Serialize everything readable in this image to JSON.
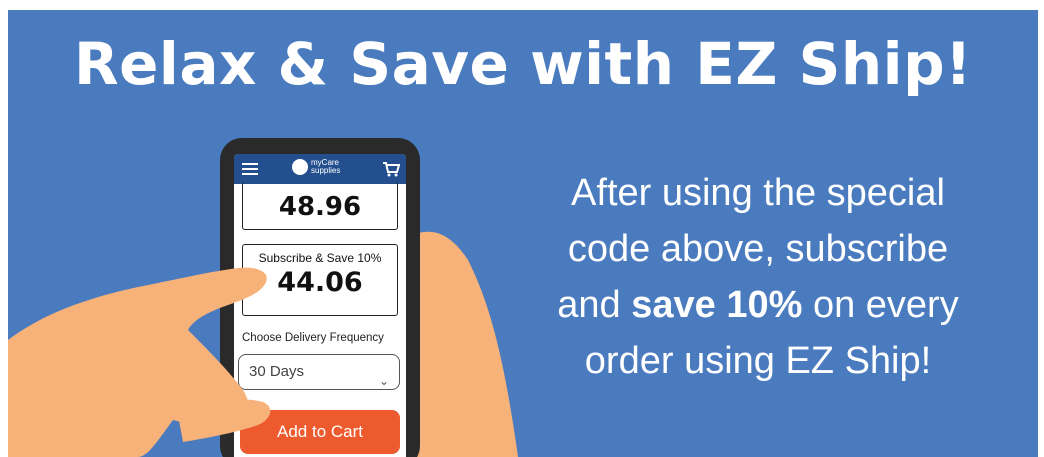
{
  "banner": {
    "headline": "Relax & Save with EZ Ship!",
    "body_line1": "After using the special",
    "body_line2": "code above, subscribe",
    "body_line3_pre": "and ",
    "body_line3_bold": "save 10%",
    "body_line3_post": " on every",
    "body_line4": "order using EZ Ship!",
    "background_color": "#4a7bbf"
  },
  "phone": {
    "logo_line1": "myCare",
    "logo_line2": "supplies",
    "menu_icon": "hamburger-menu-icon",
    "cart_icon": "shopping-cart-icon",
    "price_regular": "48.96",
    "subscribe_label": "Subscribe & Save 10%",
    "price_subscribe": "44.06",
    "frequency_label": "Choose Delivery Frequency",
    "frequency_value": "30 Days",
    "add_to_cart_label": "Add to Cart",
    "accent_color": "#ec5a2e",
    "header_color": "#234f8e"
  }
}
